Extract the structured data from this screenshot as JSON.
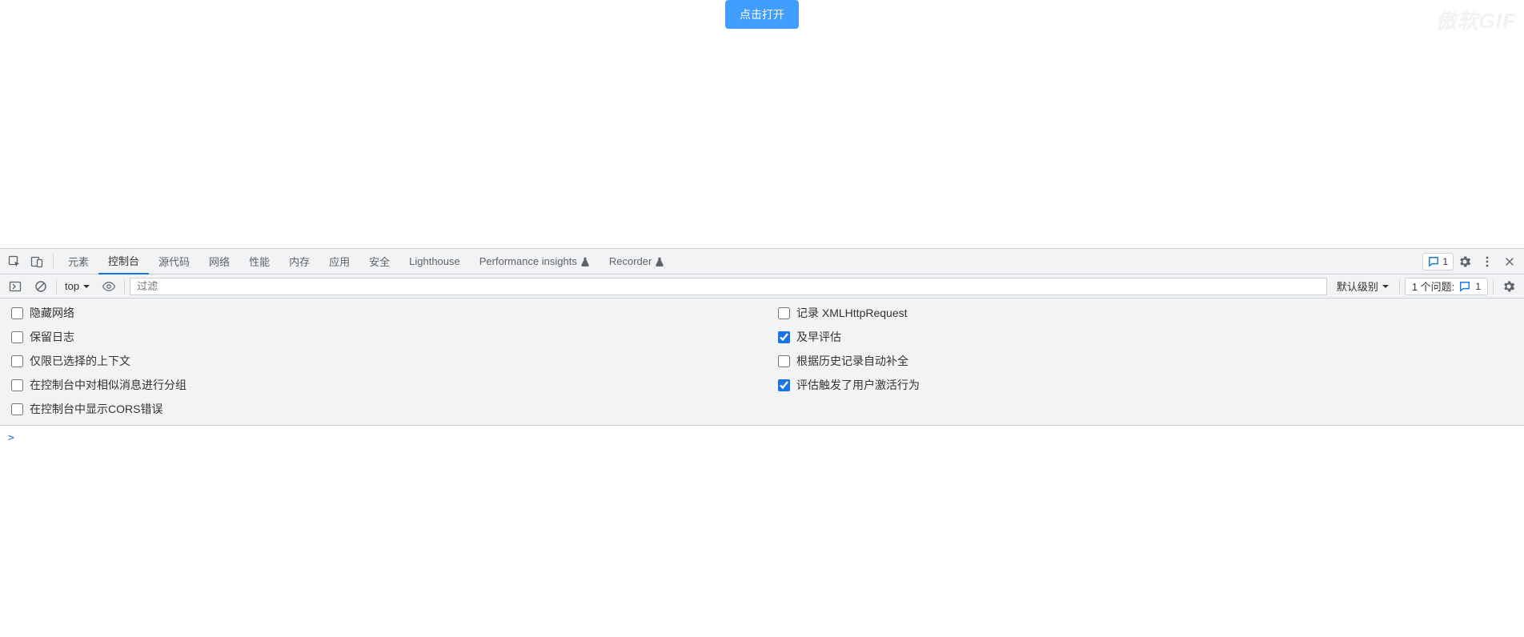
{
  "page": {
    "open_button": "点击打开",
    "watermark": "傲软GIF"
  },
  "tabs": {
    "elements": "元素",
    "console": "控制台",
    "sources": "源代码",
    "network": "网络",
    "performance": "性能",
    "memory": "内存",
    "application": "应用",
    "security": "安全",
    "lighthouse": "Lighthouse",
    "perf_insights": "Performance insights",
    "recorder": "Recorder"
  },
  "tabstrip_right": {
    "issues_badge_count": "1"
  },
  "console_toolbar": {
    "context": "top",
    "filter_placeholder": "过滤",
    "level": "默认级别",
    "issues_label": "1 个问题:",
    "issues_count": "1"
  },
  "settings": {
    "left": [
      {
        "label": "隐藏网络",
        "checked": false
      },
      {
        "label": "保留日志",
        "checked": false
      },
      {
        "label": "仅限已选择的上下文",
        "checked": false
      },
      {
        "label": "在控制台中对相似消息进行分组",
        "checked": false
      },
      {
        "label": "在控制台中显示CORS错误",
        "checked": false
      }
    ],
    "right": [
      {
        "label": "记录 XMLHttpRequest",
        "checked": false
      },
      {
        "label": "及早评估",
        "checked": true
      },
      {
        "label": "根据历史记录自动补全",
        "checked": false
      },
      {
        "label": "评估触发了用户激活行为",
        "checked": true
      }
    ]
  },
  "console": {
    "prompt": ">"
  }
}
